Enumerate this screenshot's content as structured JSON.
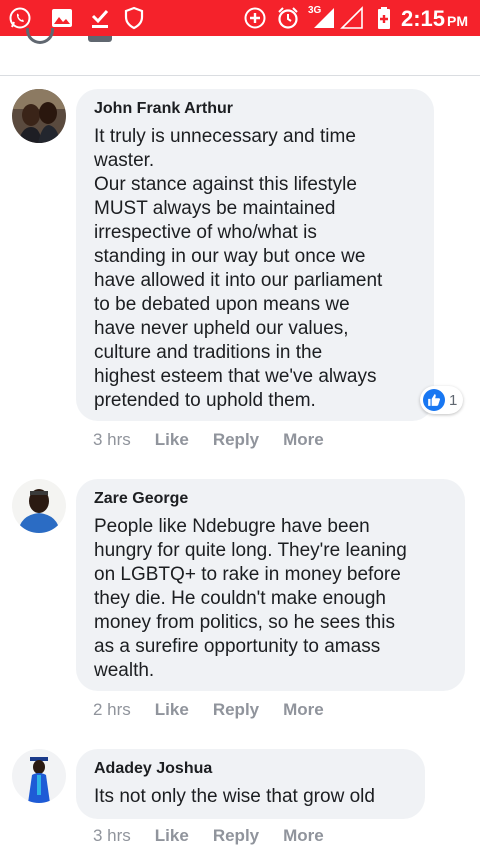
{
  "status_bar": {
    "time": "2:15",
    "ampm": "PM",
    "network": "3G",
    "icons": [
      "whatsapp-icon",
      "image-icon",
      "download-check-icon",
      "shield-icon",
      "add-circle-icon",
      "alarm-icon",
      "signal-icon",
      "no-signal-icon",
      "battery-icon"
    ]
  },
  "comments": [
    {
      "author": "John Frank Arthur",
      "text": "It truly is unnecessary and time\nwaster.\nOur stance against this lifestyle\nMUST always be maintained\nirrespective of who/what is\nstanding in our way but once we\nhave allowed it into our parliament\nto be debated upon means we\nhave never upheld our values,\nculture and traditions in the\nhighest esteem that we've always\npretended to uphold them.",
      "time": "3 hrs",
      "like": "Like",
      "reply": "Reply",
      "more": "More",
      "reaction_count": "1"
    },
    {
      "author": "Zare George",
      "text": "People like Ndebugre have been\nhungry for quite long. They're leaning\non LGBTQ+ to rake in money before\nthey die. He couldn't make enough\nmoney from politics, so he sees this\nas a surefire opportunity to amass\nwealth.",
      "time": "2 hrs",
      "like": "Like",
      "reply": "Reply",
      "more": "More"
    },
    {
      "author": "Adadey Joshua",
      "text": "Its not only the wise that grow old",
      "time": "3 hrs",
      "like": "Like",
      "reply": "Reply",
      "more": "More"
    }
  ],
  "colors": {
    "status_bar": "#f5222b",
    "bubble": "#f0f2f5",
    "like_blue": "#1877f2",
    "meta_gray": "#90949c"
  }
}
